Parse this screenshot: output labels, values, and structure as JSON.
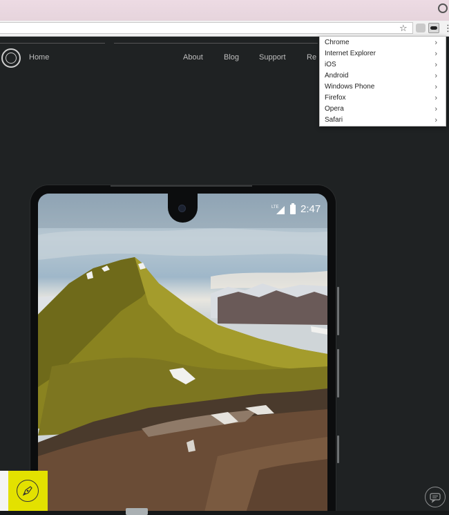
{
  "browser": {
    "address_value": "",
    "extension_menu": {
      "items": [
        {
          "label": "Chrome"
        },
        {
          "label": "Internet Explorer"
        },
        {
          "label": "iOS"
        },
        {
          "label": "Android"
        },
        {
          "label": "Windows Phone"
        },
        {
          "label": "Firefox"
        },
        {
          "label": "Opera"
        },
        {
          "label": "Safari"
        }
      ]
    }
  },
  "site": {
    "nav": {
      "home": "Home",
      "about": "About",
      "blog": "Blog",
      "support": "Support",
      "partial": "Re"
    }
  },
  "phone": {
    "network": "LTE",
    "time": "2:47"
  },
  "colors": {
    "page_bg": "#1f2223",
    "badge": "#e3e100",
    "dropdown_bg": "#ffffff"
  }
}
